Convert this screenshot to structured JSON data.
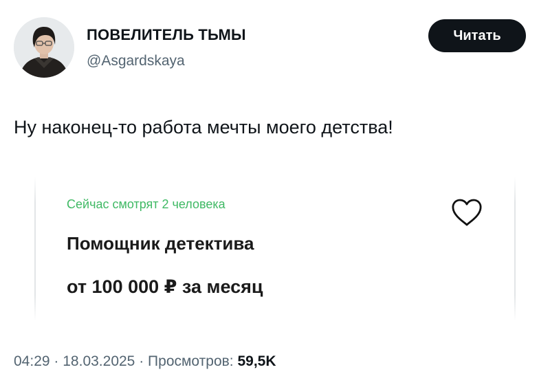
{
  "author": {
    "display_name": "ПОВЕЛИТЕЛЬ ТЬМЫ",
    "handle": "@Asgardskaya"
  },
  "follow_button": {
    "label": "Читать"
  },
  "tweet": {
    "text": "Ну наконец-то работа мечты моего детства!"
  },
  "vacancy_card": {
    "viewers_text": "Сейчас смотрят 2 человека",
    "title": "Помощник детектива",
    "salary": "от 100 000 ₽ за месяц",
    "favorite_icon": "heart-outline-icon",
    "accent_color": "#3fb964"
  },
  "meta": {
    "time": "04:29",
    "separator": "·",
    "date": "18.03.2025",
    "views_label": "Просмотров:",
    "views_count": "59,5K"
  }
}
